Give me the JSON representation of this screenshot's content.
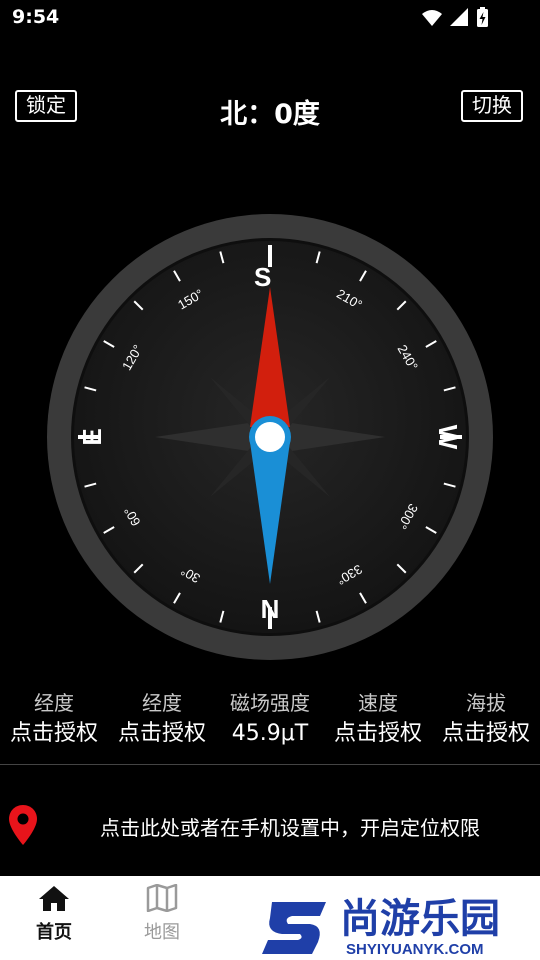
{
  "status_bar": {
    "time": "9:54",
    "icons": [
      "wifi-icon",
      "signal-icon",
      "battery-charging-icon"
    ]
  },
  "header": {
    "lock_label": "锁定",
    "title": "北：0度",
    "switch_label": "切换"
  },
  "compass": {
    "heading_degrees": 0,
    "cardinals": {
      "north": "N",
      "south": "S",
      "east": "E",
      "west": "W"
    },
    "degree_labels": [
      "30°",
      "60°",
      "120°",
      "150°",
      "210°",
      "240°",
      "300°",
      "330°"
    ],
    "colors": {
      "north_needle": "#1a8fd6",
      "south_needle": "#d21f0d",
      "bezel": "#3a3a3a",
      "face": "#1c1c1c"
    }
  },
  "info": [
    {
      "label": "经度",
      "value": "点击授权"
    },
    {
      "label": "经度",
      "value": "点击授权"
    },
    {
      "label": "磁场强度",
      "value": "45.9μT"
    },
    {
      "label": "速度",
      "value": "点击授权"
    },
    {
      "label": "海拔",
      "value": "点击授权"
    }
  ],
  "location": {
    "text": "点击此处或者在手机设置中，开启定位权限",
    "pin_color": "#e8141b"
  },
  "tabs": [
    {
      "label": "首页",
      "icon": "home-icon",
      "active": true
    },
    {
      "label": "地图",
      "icon": "map-icon",
      "active": false
    }
  ],
  "watermark": {
    "brand": "尚游乐园",
    "url": "SHYIYUANYK.COM",
    "brand_color": "#1f3fa8"
  }
}
